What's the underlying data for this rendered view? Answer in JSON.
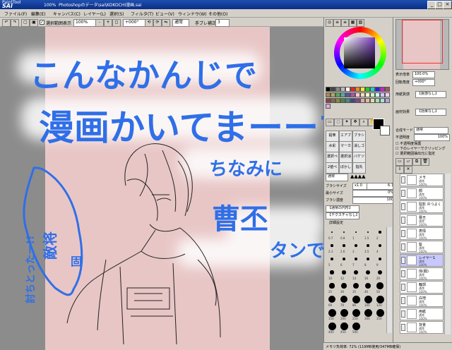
{
  "window": {
    "app_logo_top": "PaintTool",
    "app_logo_main": "SAI",
    "title": "Photoshopのデータ\\sai\\KOKOCHI漫画.sai",
    "title_prefix": "100%"
  },
  "menu": [
    {
      "label": "ファイル(F)"
    },
    {
      "label": "編集(E)"
    },
    {
      "label": "キャンバス(C)"
    },
    {
      "label": "レイヤー(L)"
    },
    {
      "label": "選択(S)"
    },
    {
      "label": "フィルタ(T)"
    },
    {
      "label": "ビュー(V)"
    },
    {
      "label": "ウィンドウ(W)"
    },
    {
      "label": "その他(O)"
    }
  ],
  "toolbar": {
    "show_selection_label": "選択範囲表示",
    "zoom_value": "100%",
    "angle_value": "+000°",
    "blend_value": "通常",
    "stabilizer_label": "手ブレ補正",
    "stabilizer_value": "3"
  },
  "canvas": {
    "handwriting_line1": "こんなかんじで",
    "handwriting_line2": "漫画かいてまーーす。",
    "handwriting_aside1": "ちなみに",
    "handwriting_aside2": "曹丕",
    "handwriting_aside3": "タンです。",
    "handwriting_left1": "敵将",
    "handwriting_left2": "討ちとったー!!",
    "handwriting_small": "固",
    "note_color": "#2f6fe8",
    "paper_color": "#e8c6c6"
  },
  "navigator": {
    "zoom_label": "表示倍率",
    "zoom_value": "100.0%",
    "angle_label": "回転角度",
    "angle_value": "+000°"
  },
  "color_panel": {
    "foreground": "#000000",
    "background": "#ffffff",
    "hue_accent": "#6a3fa0"
  },
  "layer_props": {
    "paper_texture_label": "用紙質感",
    "paper_texture_value": "【質感なし】",
    "paper_effect_label": "画材効果",
    "paper_effect_value": "【効果なし】",
    "blend_mode_label": "合成モード",
    "blend_mode_value": "通常",
    "opacity_label": "不透明度",
    "opacity_value": "100%",
    "protect_label": "不透明度保護",
    "clip_label": "下のレイヤーでクリッピング",
    "ref_label": "指定範囲に指定",
    "select_source_label": "選択範囲抽出元に指定"
  },
  "brush": {
    "mode_label": "通常",
    "size_label": "ブラシサイズ",
    "size_mult": "x1.0",
    "size_value": "6.7",
    "min_size_label": "最小サイズ",
    "min_size_value": "0%",
    "density_label": "ブラシ濃度",
    "density_value": "100",
    "shape_value": "【通常の円形】",
    "texture_value": "【テクスチャなし】",
    "detail_label": "詳細設定",
    "sizes": [
      "0.7",
      "0.8",
      "1",
      "1.5",
      "2",
      "2.3",
      "2.6",
      "3",
      "3.5",
      "4",
      "5",
      "6",
      "7",
      "8",
      "9",
      "10",
      "12",
      "14",
      "16",
      "20",
      "25",
      "30",
      "35",
      "40",
      "50",
      "60",
      "70",
      "80",
      "100",
      "120",
      "150",
      "200",
      "250",
      "300",
      "350",
      "400",
      "450",
      "500"
    ]
  },
  "tools": [
    {
      "label": "鉛筆"
    },
    {
      "label": "エアブラシ"
    },
    {
      "label": "ブラシ"
    },
    {
      "label": "水彩"
    },
    {
      "label": "マーカー"
    },
    {
      "label": "消しゴム"
    },
    {
      "label": "選択ペン"
    },
    {
      "label": "選択消し"
    },
    {
      "label": "バケツ"
    },
    {
      "label": "2値ペン"
    },
    {
      "label": "ぼかし"
    },
    {
      "label": "指先"
    }
  ],
  "layers": [
    {
      "name": "メモ",
      "mode": "通常",
      "opacity": "100%"
    },
    {
      "name": "顔",
      "mode": "通常",
      "opacity": "100%"
    },
    {
      "name": "陰影 炎つよく",
      "mode": "通常",
      "opacity": "100%"
    },
    {
      "name": "曹丕",
      "mode": "通常",
      "opacity": "100%"
    },
    {
      "name": "表情",
      "mode": "通常",
      "opacity": "100%"
    },
    {
      "name": "髪",
      "mode": "通常",
      "opacity": "100%"
    },
    {
      "name": "レイヤー1",
      "mode": "通常",
      "opacity": "100%"
    },
    {
      "name": "体(服)",
      "mode": "通常",
      "opacity": "100%"
    },
    {
      "name": "輪郭",
      "mode": "通常",
      "opacity": "100%"
    },
    {
      "name": "白地",
      "mode": "通常",
      "opacity": "100%"
    },
    {
      "name": "用紙",
      "mode": "通常",
      "opacity": "100%"
    },
    {
      "name": "背景",
      "mode": "通常",
      "opacity": "100%"
    }
  ],
  "status": {
    "memory": "メモリ負荷率: 72% (119MB使用/347MB確保)"
  }
}
